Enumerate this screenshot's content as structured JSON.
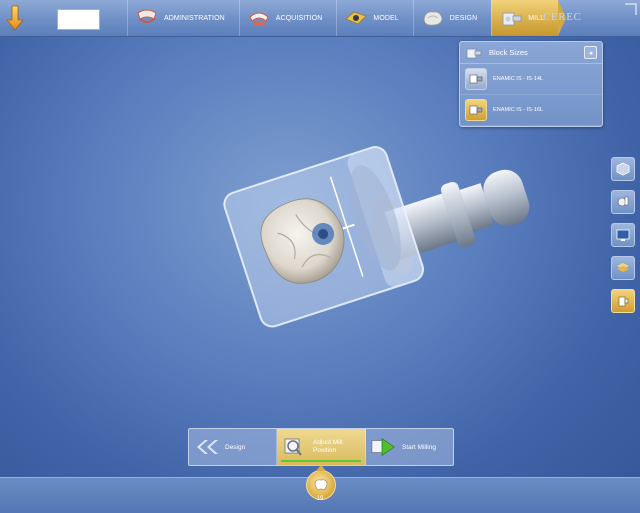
{
  "topbar": {
    "steps": [
      {
        "label": "ADMINISTRATION",
        "icon": "administration-icon"
      },
      {
        "label": "ACQUISITION",
        "icon": "acquisition-icon"
      },
      {
        "label": "MODEL",
        "icon": "model-icon"
      },
      {
        "label": "DESIGN",
        "icon": "design-icon"
      },
      {
        "label": "MILL",
        "icon": "mill-icon",
        "active": true
      }
    ],
    "brand": "CEREC",
    "case_field": ""
  },
  "panel": {
    "title": "Block Sizes",
    "items": [
      {
        "label": "ENAMIC IS - IS-14L",
        "selected": false
      },
      {
        "label": "ENAMIC IS - IS-16L",
        "selected": true
      }
    ]
  },
  "tools": [
    "cube-view-icon",
    "mill-tool-icon",
    "monitor-icon",
    "layers-icon",
    "block-position-icon"
  ],
  "wizard": {
    "back_label": "Design",
    "current_label": "Adjust Mill Position",
    "next_label": "Start Milling"
  },
  "tooth": {
    "number": "19"
  },
  "colors": {
    "accent_gold": "#d7ad48",
    "progress_green": "#5fc72f",
    "background_blue": "#5b7fbf"
  }
}
